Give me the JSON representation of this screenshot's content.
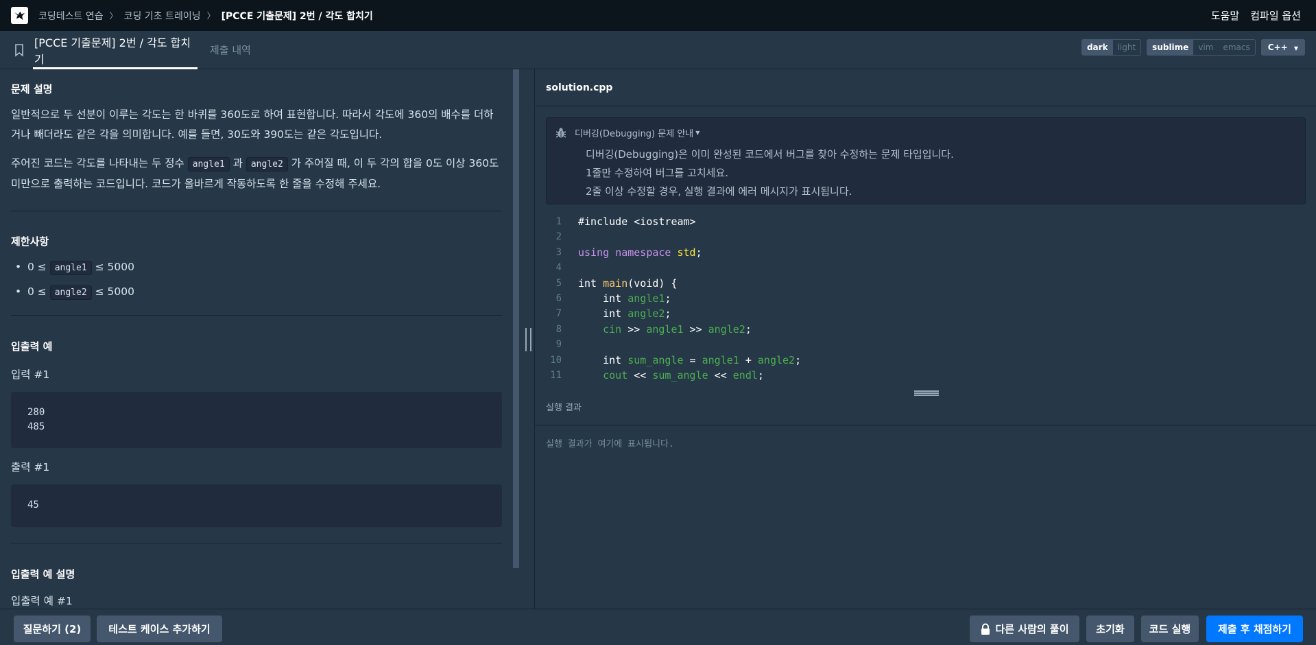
{
  "nav": {
    "breadcrumbs": [
      "코딩테스트 연습",
      "코딩 기초 트레이닝",
      "[PCCE 기출문제] 2번 / 각도 합치기"
    ],
    "help": "도움말",
    "compile_options": "컴파일 옵션"
  },
  "tabs": {
    "active": "[PCCE 기출문제] 2번 / 각도 합치기",
    "submissions": "제출 내역"
  },
  "toolbar": {
    "theme_dark": "dark",
    "theme_light": "light",
    "keymap_sublime": "sublime",
    "keymap_vim": "vim",
    "keymap_emacs": "emacs",
    "language": "C++"
  },
  "problem": {
    "desc_title": "문제 설명",
    "desc_p1": "일반적으로 두 선분이 이루는 각도는 한 바퀴를 360도로 하여 표현합니다. 따라서 각도에 360의 배수를 더하거나 빼더라도 같은 각을 의미합니다. 예를 들면, 30도와 390도는 같은 각도입니다.",
    "desc_p2_a": "주어진 코드는 각도를 나타내는 두 정수 ",
    "desc_p2_code1": "angle1",
    "desc_p2_b": " 과 ",
    "desc_p2_code2": "angle2",
    "desc_p2_c": " 가 주어질 때, 이 두 각의 합을 0도 이상 360도 미만으로 출력하는 코드입니다. 코드가 올바르게 작동하도록 한 줄을 수정해 주세요.",
    "limits_title": "제한사항",
    "limit1_pre": "0 ≤ ",
    "limit1_code": "angle1",
    "limit1_post": " ≤ 5000",
    "limit2_pre": "0 ≤ ",
    "limit2_code": "angle2",
    "limit2_post": " ≤ 5000",
    "io_title": "입출력 예",
    "input_label": "입력 #1",
    "input_line1": "280",
    "input_line2": "485",
    "output_label": "출력 #1",
    "output_line1": "45",
    "io_explain_title": "입출력 예 설명",
    "io_explain_sub": "입출력 예 #1"
  },
  "editor": {
    "filename": "solution.cpp",
    "debug_title": "디버깅(Debugging) 문제 안내",
    "debug_line1": "디버깅(Debugging)은 이미 완성된 코드에서 버그를 찾아 수정하는 문제 타입입니다.",
    "debug_line2": "1줄만 수정하여 버그를 고치세요.",
    "debug_line3": "2줄 이상 수정할 경우, 실행 결과에 에러 메시지가 표시됩니다.",
    "line_numbers": [
      "1",
      "2",
      "3",
      "4",
      "5",
      "6",
      "7",
      "8",
      "9",
      "10",
      "11"
    ],
    "code": {
      "l1": "#include <iostream>",
      "l3_kw1": "using",
      "l3_kw2": "namespace",
      "l3_ns": "std",
      "l3_end": ";",
      "l5_type": "int",
      "l5_fn": "main",
      "l5_rest": "(void) {",
      "l6_type": "int",
      "l6_var": "angle1",
      "l7_type": "int",
      "l7_var": "angle2",
      "l8_cin": "cin",
      "l8_op": " >> ",
      "l8_v1": "angle1",
      "l8_v2": "angle2",
      "l10_type": "int",
      "l10_var": "sum_angle",
      "l10_eq": " = ",
      "l10_v1": "angle1",
      "l10_plus": " + ",
      "l10_v2": "angle2",
      "l11_cout": "cout",
      "l11_op": " << ",
      "l11_v": "sum_angle",
      "l11_endl": "endl",
      "semicolon": ";"
    },
    "result_title": "실행 결과",
    "result_placeholder": "실행 결과가 여기에 표시됩니다."
  },
  "bottom": {
    "question_btn": "질문하기 (2)",
    "add_testcase_btn": "테스트 케이스 추가하기",
    "others_solution_btn": "다른 사람의 풀이",
    "reset_btn": "초기화",
    "run_btn": "코드 실행",
    "submit_btn": "제출 후 채점하기"
  }
}
